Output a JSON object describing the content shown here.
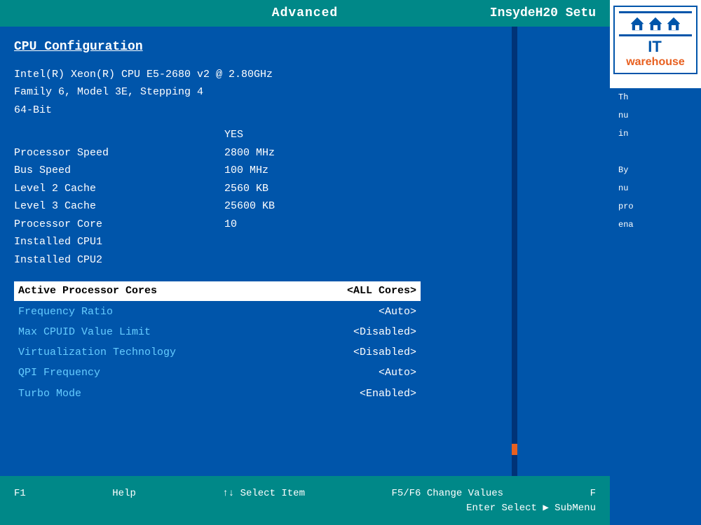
{
  "header": {
    "title": "Advanced",
    "right_title": "InsydeH20 Setu"
  },
  "logo": {
    "it_text": "IT",
    "warehouse_text": "warehouse"
  },
  "section": {
    "title": "CPU Configuration"
  },
  "cpu_info": {
    "line1": "Intel(R) Xeon(R) CPU E5-2680 v2 @ 2.80GHz",
    "line2": "Family 6, Model 3E, Stepping 4",
    "line3": "64-Bit"
  },
  "specs": [
    {
      "label": "",
      "value": "YES"
    },
    {
      "label": "Processor Speed",
      "value": "2800 MHz"
    },
    {
      "label": "Bus Speed",
      "value": "100 MHz"
    },
    {
      "label": "Level 2 Cache",
      "value": "2560 KB"
    },
    {
      "label": "Level 3 Cache",
      "value": "25600 KB"
    },
    {
      "label": "Processor Core",
      "value": "10"
    },
    {
      "label": "Installed CPU1",
      "value": ""
    },
    {
      "label": "Installed CPU2",
      "value": ""
    }
  ],
  "menu_items": [
    {
      "label": "Active Processor Cores",
      "value": "<ALL Cores>",
      "highlighted": true
    },
    {
      "label": "Frequency Ratio",
      "value": "<Auto>",
      "highlighted": false
    },
    {
      "label": "Max CPUID Value Limit",
      "value": "<Disabled>",
      "highlighted": false
    },
    {
      "label": "Virtualization Technology",
      "value": "<Disabled>",
      "highlighted": false
    },
    {
      "label": "QPI Frequency",
      "value": "<Auto>",
      "highlighted": false
    },
    {
      "label": "Turbo Mode",
      "value": "<Enabled>",
      "highlighted": false
    }
  ],
  "footer": {
    "row1_left_key": "F1",
    "row1_left_desc": "Help",
    "row1_mid_key": "↑↓ Select Item",
    "row1_right_key": "F5/F6",
    "row1_right_desc": "Change Values",
    "row2_left_key": "",
    "row2_left_desc": "",
    "row2_mid_key": "Enter  Select",
    "row2_right_key": "▶",
    "row2_right_desc": "SubMenu"
  },
  "sidebar": {
    "help_lines": [
      "Th",
      "nu",
      "in",
      "",
      "By",
      "nu",
      "pro",
      "ena"
    ]
  }
}
